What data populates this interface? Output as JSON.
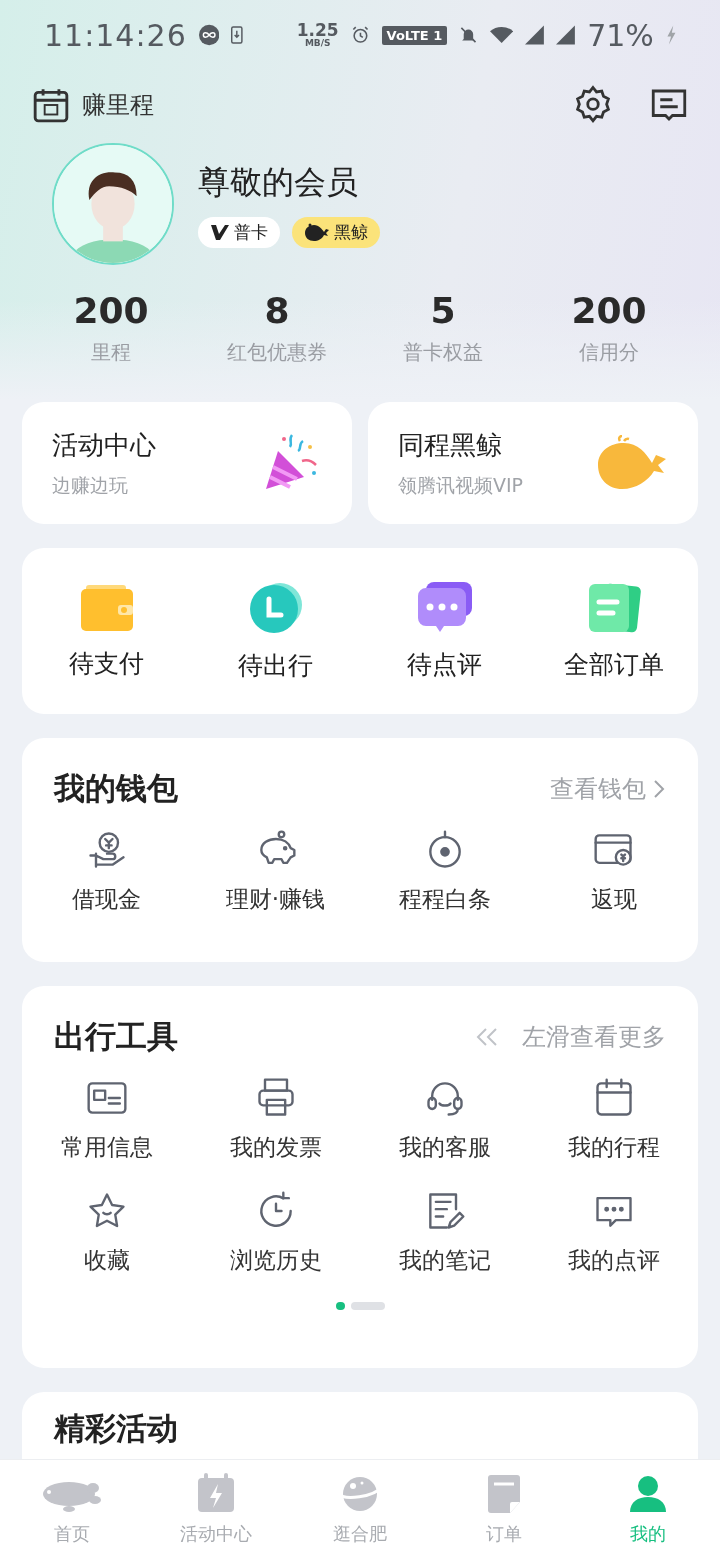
{
  "status_bar": {
    "time": "11:14:26",
    "net_speed": "1.25",
    "net_unit": "MB/S",
    "volte": "VoLTE 1",
    "battery": "71%"
  },
  "header": {
    "checkin_label": "赚里程"
  },
  "profile": {
    "name": "尊敬的会员",
    "badges": [
      {
        "kind": "card",
        "label": "普卡"
      },
      {
        "kind": "whale",
        "label": "黑鲸"
      }
    ]
  },
  "stats": [
    {
      "value": "200",
      "label": "里程"
    },
    {
      "value": "8",
      "label": "红包优惠券"
    },
    {
      "value": "5",
      "label": "普卡权益"
    },
    {
      "value": "200",
      "label": "信用分"
    }
  ],
  "promo_cards": [
    {
      "title": "活动中心",
      "subtitle": "边赚边玩",
      "kind": "party"
    },
    {
      "title": "同程黑鲸",
      "subtitle": "领腾讯视频VIP",
      "kind": "whale"
    }
  ],
  "orders": [
    {
      "label": "待支付",
      "kind": "wallet"
    },
    {
      "label": "待出行",
      "kind": "clock"
    },
    {
      "label": "待点评",
      "kind": "chat"
    },
    {
      "label": "全部订单",
      "kind": "docs"
    }
  ],
  "wallet": {
    "title": "我的钱包",
    "link": "查看钱包",
    "items": [
      {
        "label": "借现金",
        "kind": "cash"
      },
      {
        "label": "理财·赚钱",
        "kind": "piggy"
      },
      {
        "label": "程程白条",
        "kind": "target"
      },
      {
        "label": "返现",
        "kind": "card"
      }
    ]
  },
  "tools": {
    "title": "出行工具",
    "hint": "左滑查看更多",
    "items": [
      {
        "label": "常用信息",
        "kind": "idcard"
      },
      {
        "label": "我的发票",
        "kind": "printer"
      },
      {
        "label": "我的客服",
        "kind": "headset"
      },
      {
        "label": "我的行程",
        "kind": "calendar"
      },
      {
        "label": "收藏",
        "kind": "star"
      },
      {
        "label": "浏览历史",
        "kind": "history"
      },
      {
        "label": "我的笔记",
        "kind": "note"
      },
      {
        "label": "我的点评",
        "kind": "comment"
      }
    ],
    "pages": [
      {
        "selected": true
      },
      {
        "selected": false
      }
    ]
  },
  "events": {
    "title": "精彩活动"
  },
  "nav": [
    {
      "label": "首页",
      "kind": "home",
      "selected": false
    },
    {
      "label": "活动中心",
      "kind": "activity",
      "selected": false
    },
    {
      "label": "逛合肥",
      "kind": "planet",
      "selected": false
    },
    {
      "label": "订单",
      "kind": "order",
      "selected": false
    },
    {
      "label": "我的",
      "kind": "me",
      "selected": true
    }
  ]
}
